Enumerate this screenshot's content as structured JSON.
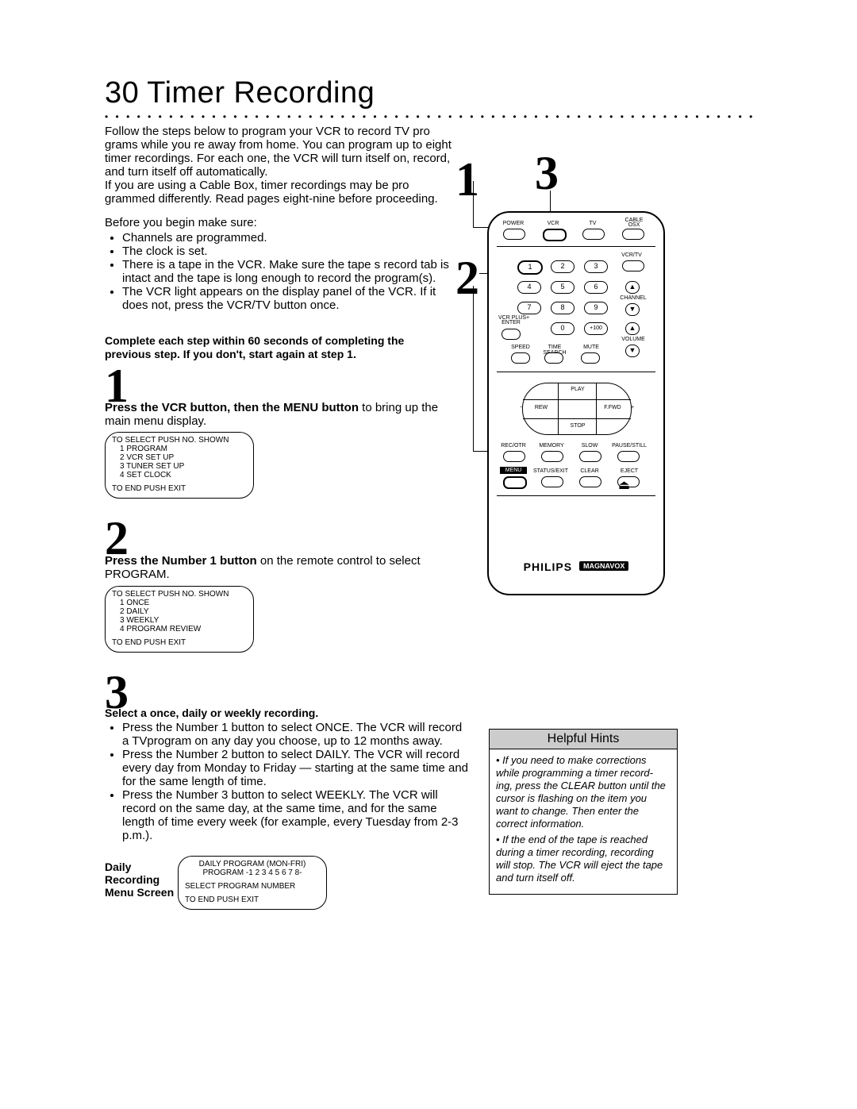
{
  "page_number": "30",
  "title_text": "Timer Recording",
  "dots_row": "• • • • • • • • • • • • • • • • • • • • • • • • • • • • • • • • • • • • • • • • • • • • • • • • • • • • • • • • • • • • • • • • • • • • • • • • • • • • • • • • • • • • • • • • • • • • • • • • • • • • • • • • • •",
  "intro_p1": "Follow the steps below to program your VCR to record TV pro grams while you re away from home. You can program up to eight timer recordings. For each one, the VCR will turn itself on, record, and turn itself off automatically.",
  "intro_p2": "If you are using a Cable Box, timer recordings may be pro grammed differently. Read pages eight-nine before proceeding.",
  "prereq_lead": "Before you begin make sure:",
  "prereq_items": [
    "Channels are programmed.",
    "The clock is set.",
    "There is a tape in the VCR.  Make sure the tape s record tab is intact and the tape is long enough to record the program(s).",
    "The VCR light appears on the display panel of the VCR. If it does not, press the VCR/TV button once."
  ],
  "complete_warning": "Complete each step within 60 seconds of completing the previous step. If you don't, start again at step 1.",
  "callouts": {
    "n1": "1",
    "n2": "2",
    "n3": "3"
  },
  "steps": {
    "n1": "1",
    "n2": "2",
    "n3": "3",
    "s1_strong": "Press the VCR button, then the MENU button",
    "s1_rest": " to bring up the main menu display.",
    "s2_strong": "Press the Number 1 button",
    "s2_rest": " on the remote control to select PROGRAM.",
    "s3_head": "Select a once, daily or weekly recording.",
    "s3_items": [
      "Press the Number 1 button to select ONCE. The VCR will record a TVprogram on any day you choose, up to 12 months away.",
      "Press the Number 2 button to select DAILY. The VCR will record every day from Monday to Friday — starting at the same time and for the same length of time.",
      "Press the Number 3 button to select WEEKLY. The VCR will record on the same day, at the same time, and for the same length of time every week (for example, every Tuesday from 2-3 p.m.)."
    ]
  },
  "osd1": {
    "title": "TO SELECT PUSH NO. SHOWN",
    "items": [
      "1 PROGRAM",
      "2 VCR SET UP",
      "3 TUNER SET UP",
      "4 SET CLOCK"
    ],
    "footer": "TO END PUSH EXIT"
  },
  "osd2": {
    "title": "TO SELECT PUSH NO. SHOWN",
    "items": [
      "1 ONCE",
      "2 DAILY",
      "3 WEEKLY",
      "4 PROGRAM REVIEW"
    ],
    "footer": "TO END PUSH EXIT"
  },
  "daily_label": "Daily Recording Menu Screen",
  "osd3": {
    "l1": "DAILY PROGRAM (MON-FRI)",
    "l2": "PROGRAM    -1 2 3 4 5 6 7 8-",
    "l3": "SELECT PROGRAM NUMBER",
    "l4": "TO END PUSH EXIT"
  },
  "remote": {
    "row1_labels": [
      "POWER",
      "VCR",
      "TV",
      "CABLE OSX"
    ],
    "num_labels": [
      "1",
      "2",
      "3",
      "4",
      "5",
      "6",
      "7",
      "8",
      "9",
      "0",
      "+100"
    ],
    "vcrtv": "VCR/TV",
    "channel": "CHANNEL",
    "vcrplus": "VCR PLUS+\nENTER",
    "volume": "VOLUME",
    "row_small": [
      "SPEED",
      "TIME SEARCH",
      "MUTE"
    ],
    "transport": {
      "play": "PLAY",
      "rew": "REW",
      "ffwd": "F.FWD",
      "stop": "STOP",
      "minus": "−",
      "plus": "+"
    },
    "row_bottom1": [
      "REC/OTR",
      "MEMORY",
      "SLOW",
      "PAUSE/STILL"
    ],
    "row_bottom2": [
      "MENU",
      "STATUS/EXIT",
      "CLEAR",
      "EJECT"
    ],
    "brand": "PHILIPS",
    "brand2": "MAGNAVOX"
  },
  "hints": {
    "heading": "Helpful Hints",
    "items": [
      "If you need to make corrections while programming a timer record- ing, press the CLEAR button until the cursor is flashing on the item you want to change. Then enter the correct information.",
      "If the end of the tape is reached during a timer recording, recording will stop. The VCR will eject the tape and turn itself off."
    ]
  }
}
